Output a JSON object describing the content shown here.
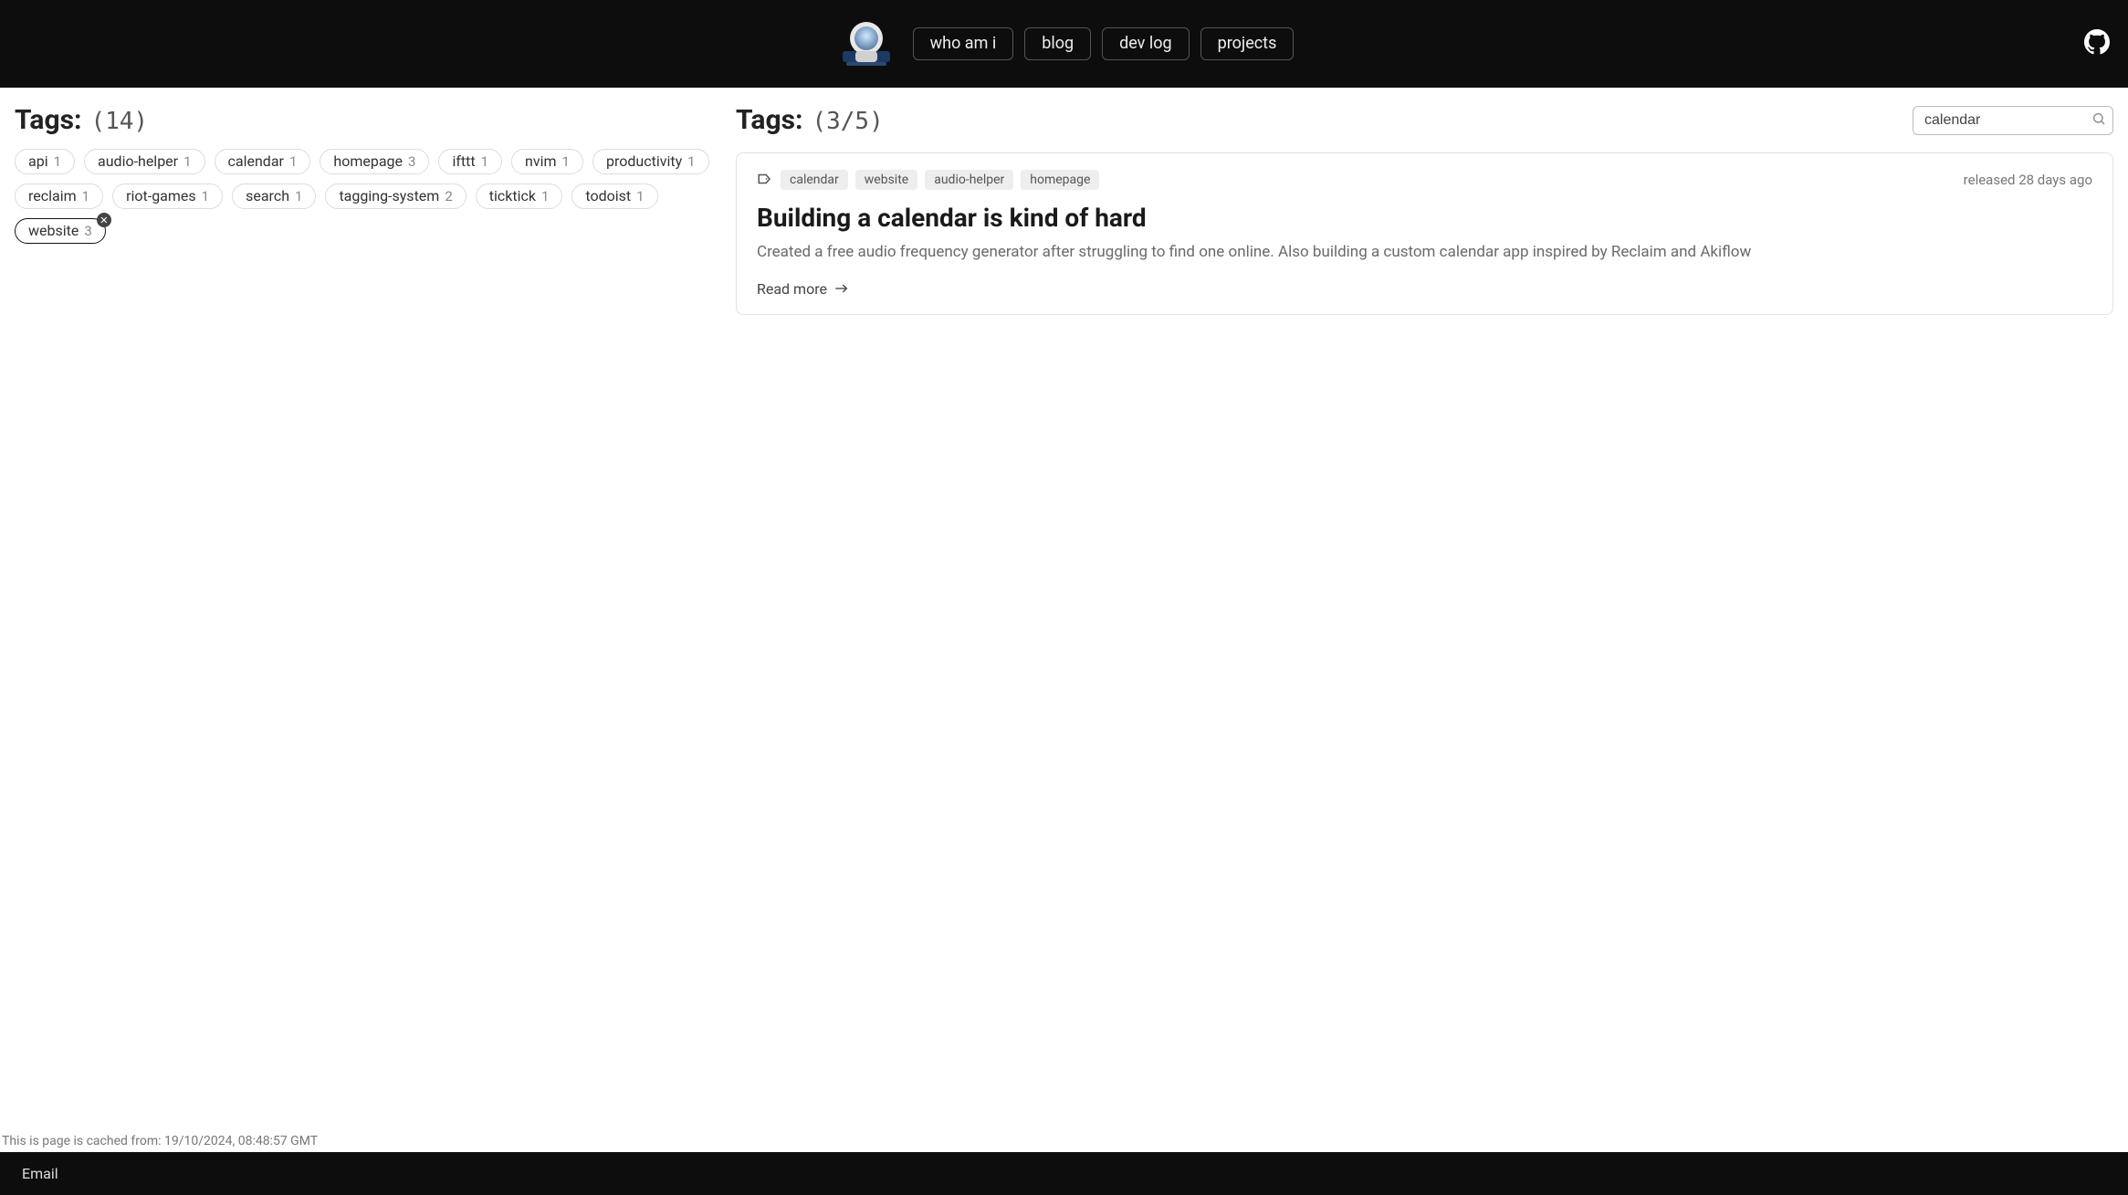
{
  "nav": {
    "links": [
      "who am i",
      "blog",
      "dev log",
      "projects"
    ]
  },
  "sidebar": {
    "heading": "Tags:",
    "count": "(14)",
    "tags": [
      {
        "name": "api",
        "count": "1",
        "selected": false
      },
      {
        "name": "audio-helper",
        "count": "1",
        "selected": false
      },
      {
        "name": "calendar",
        "count": "1",
        "selected": false
      },
      {
        "name": "homepage",
        "count": "3",
        "selected": false
      },
      {
        "name": "ifttt",
        "count": "1",
        "selected": false
      },
      {
        "name": "nvim",
        "count": "1",
        "selected": false
      },
      {
        "name": "productivity",
        "count": "1",
        "selected": false
      },
      {
        "name": "reclaim",
        "count": "1",
        "selected": false
      },
      {
        "name": "riot-games",
        "count": "1",
        "selected": false
      },
      {
        "name": "search",
        "count": "1",
        "selected": false
      },
      {
        "name": "tagging-system",
        "count": "2",
        "selected": false
      },
      {
        "name": "ticktick",
        "count": "1",
        "selected": false
      },
      {
        "name": "todoist",
        "count": "1",
        "selected": false
      },
      {
        "name": "website",
        "count": "3",
        "selected": true
      }
    ]
  },
  "main": {
    "heading": "Tags:",
    "count": "(3/5)",
    "search_value": "calendar",
    "released": "released 28 days ago",
    "card": {
      "tags": [
        "calendar",
        "website",
        "audio-helper",
        "homepage"
      ],
      "title": "Building a calendar is kind of hard",
      "desc": "Created a free audio frequency generator after struggling to find one online. Also building a custom calendar app inspired by Reclaim and Akiflow",
      "read_more": "Read more"
    }
  },
  "cache_note": "This is page is cached from: 19/10/2024, 08:48:57 GMT",
  "footer": {
    "email": "Email"
  }
}
